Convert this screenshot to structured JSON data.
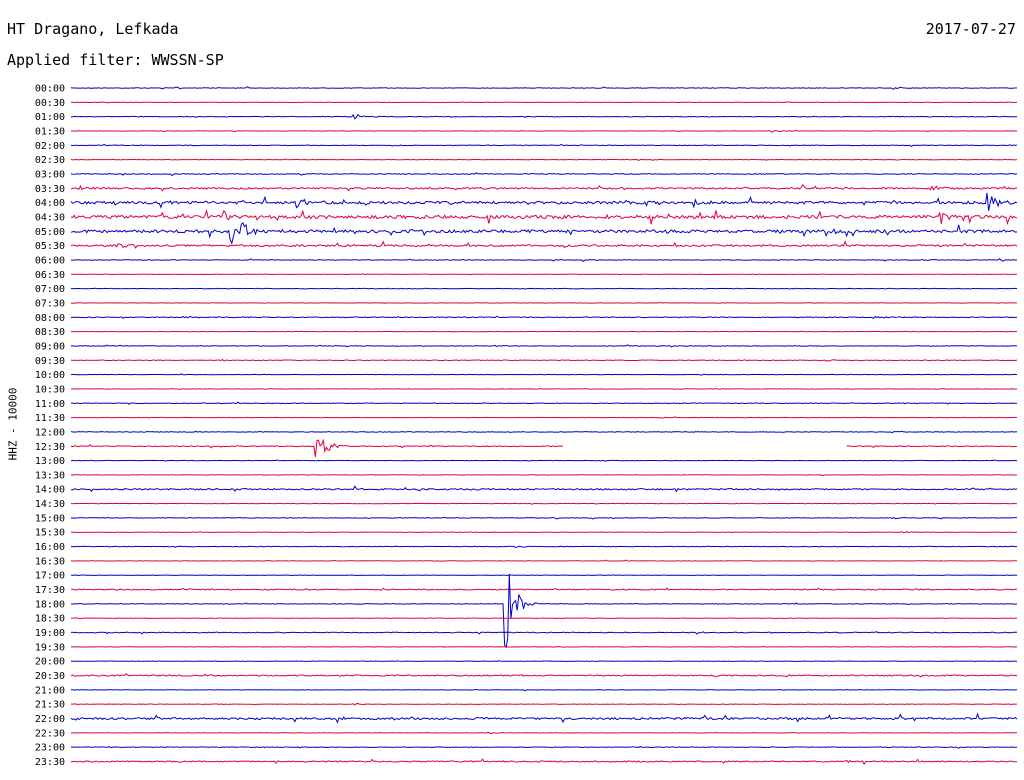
{
  "header": {
    "station": "HT Dragano, Lefkada",
    "date": "2017-07-27",
    "filter": "Applied filter: WWSSN-SP"
  },
  "colors": {
    "trace_a": "#0000cc",
    "trace_b": "#e0003a"
  },
  "chart_data": {
    "type": "line",
    "title": "HT Dragano, Lefkada",
    "subtitle": "Applied filter: WWSSN-SP",
    "ylabel": "HHZ - 10000",
    "xlabel": "",
    "grid": false,
    "legend": "none",
    "rows": [
      {
        "label": "00:00",
        "color": "blue",
        "noise": 0.3,
        "events": [
          {
            "x": 0.11,
            "a": 1
          },
          {
            "x": 0.87,
            "a": 1.2
          }
        ]
      },
      {
        "label": "00:30",
        "color": "red",
        "noise": 0.2,
        "events": []
      },
      {
        "label": "01:00",
        "color": "blue",
        "noise": 0.3,
        "events": [
          {
            "x": 0.3,
            "a": 4
          }
        ]
      },
      {
        "label": "01:30",
        "color": "red",
        "noise": 0.2,
        "events": [
          {
            "x": 0.74,
            "a": 2
          }
        ]
      },
      {
        "label": "02:00",
        "color": "blue",
        "noise": 0.3,
        "events": [
          {
            "x": 0.34,
            "a": 1.5
          }
        ]
      },
      {
        "label": "02:30",
        "color": "red",
        "noise": 0.2,
        "events": []
      },
      {
        "label": "03:00",
        "color": "blue",
        "noise": 0.4,
        "events": []
      },
      {
        "label": "03:30",
        "color": "red",
        "noise": 0.8,
        "events": [
          {
            "x": 0.01,
            "a": 3
          },
          {
            "x": 0.91,
            "a": 3
          }
        ]
      },
      {
        "label": "04:00",
        "color": "blue",
        "noise": 1.3,
        "events": [
          {
            "x": 0.24,
            "a": 6
          },
          {
            "x": 0.61,
            "a": 3
          },
          {
            "x": 0.66,
            "a": 4
          },
          {
            "x": 0.97,
            "a": 10
          }
        ]
      },
      {
        "label": "04:30",
        "color": "red",
        "noise": 1.6,
        "events": [
          {
            "x": 0.16,
            "a": 8
          },
          {
            "x": 0.92,
            "a": 5
          }
        ]
      },
      {
        "label": "05:00",
        "color": "blue",
        "noise": 1.4,
        "events": [
          {
            "x": 0.17,
            "a": 14
          },
          {
            "x": 0.18,
            "a": 10
          },
          {
            "x": 0.8,
            "a": 6
          }
        ]
      },
      {
        "label": "05:30",
        "color": "red",
        "noise": 0.9,
        "events": [
          {
            "x": 0.05,
            "a": 2
          }
        ]
      },
      {
        "label": "06:00",
        "color": "blue",
        "noise": 0.3,
        "events": [
          {
            "x": 0.9,
            "a": 1
          }
        ]
      },
      {
        "label": "06:30",
        "color": "red",
        "noise": 0.2,
        "events": []
      },
      {
        "label": "07:00",
        "color": "blue",
        "noise": 0.3,
        "events": []
      },
      {
        "label": "07:30",
        "color": "red",
        "noise": 0.2,
        "events": []
      },
      {
        "label": "08:00",
        "color": "blue",
        "noise": 0.4,
        "events": [
          {
            "x": 0.12,
            "a": 1
          },
          {
            "x": 0.85,
            "a": 1
          }
        ]
      },
      {
        "label": "08:30",
        "color": "red",
        "noise": 0.2,
        "events": []
      },
      {
        "label": "09:00",
        "color": "blue",
        "noise": 0.3,
        "events": [
          {
            "x": 0.45,
            "a": 1
          }
        ]
      },
      {
        "label": "09:30",
        "color": "red",
        "noise": 0.3,
        "events": [
          {
            "x": 0.16,
            "a": 1
          },
          {
            "x": 0.8,
            "a": 1
          }
        ]
      },
      {
        "label": "10:00",
        "color": "blue",
        "noise": 0.2,
        "events": []
      },
      {
        "label": "10:30",
        "color": "red",
        "noise": 0.2,
        "events": []
      },
      {
        "label": "11:00",
        "color": "blue",
        "noise": 0.3,
        "events": [
          {
            "x": 0.22,
            "a": 1
          },
          {
            "x": 0.88,
            "a": 1
          }
        ]
      },
      {
        "label": "11:30",
        "color": "red",
        "noise": 0.2,
        "events": []
      },
      {
        "label": "12:00",
        "color": "blue",
        "noise": 0.3,
        "events": [
          {
            "x": 0.87,
            "a": 1
          }
        ]
      },
      {
        "label": "12:30",
        "color": "red",
        "noise": 0.4,
        "gap": [
          0.52,
          0.82
        ],
        "events": [
          {
            "x": 0.26,
            "a": 24
          }
        ]
      },
      {
        "label": "13:00",
        "color": "blue",
        "noise": 0.2,
        "events": []
      },
      {
        "label": "13:30",
        "color": "red",
        "noise": 0.2,
        "events": []
      },
      {
        "label": "14:00",
        "color": "blue",
        "noise": 0.7,
        "events": [
          {
            "x": 0.42,
            "a": 1.5
          }
        ]
      },
      {
        "label": "14:30",
        "color": "red",
        "noise": 0.2,
        "events": []
      },
      {
        "label": "15:00",
        "color": "blue",
        "noise": 0.3,
        "events": [
          {
            "x": 0.87,
            "a": 1
          }
        ]
      },
      {
        "label": "15:30",
        "color": "red",
        "noise": 0.2,
        "events": [
          {
            "x": 0.88,
            "a": 1
          }
        ]
      },
      {
        "label": "16:00",
        "color": "blue",
        "noise": 0.3,
        "events": [
          {
            "x": 0.47,
            "a": 1
          }
        ]
      },
      {
        "label": "16:30",
        "color": "red",
        "noise": 0.2,
        "events": []
      },
      {
        "label": "17:00",
        "color": "blue",
        "noise": 0.2,
        "events": []
      },
      {
        "label": "17:30",
        "color": "red",
        "noise": 0.5,
        "events": [
          {
            "x": 0.12,
            "a": 1
          },
          {
            "x": 0.88,
            "a": 1.2
          }
        ]
      },
      {
        "label": "18:00",
        "color": "blue",
        "noise": 0.3,
        "events": [
          {
            "x": 0.46,
            "a": 46
          }
        ]
      },
      {
        "label": "18:30",
        "color": "red",
        "noise": 0.2,
        "events": []
      },
      {
        "label": "19:00",
        "color": "blue",
        "noise": 0.4,
        "events": [
          {
            "x": 0.74,
            "a": 1
          }
        ]
      },
      {
        "label": "19:30",
        "color": "red",
        "noise": 0.2,
        "events": []
      },
      {
        "label": "20:00",
        "color": "blue",
        "noise": 0.2,
        "events": []
      },
      {
        "label": "20:30",
        "color": "red",
        "noise": 0.6,
        "events": [
          {
            "x": 0.14,
            "a": 1.2
          }
        ]
      },
      {
        "label": "21:00",
        "color": "blue",
        "noise": 0.2,
        "events": []
      },
      {
        "label": "21:30",
        "color": "red",
        "noise": 0.2,
        "events": [
          {
            "x": 0.3,
            "a": 1
          }
        ]
      },
      {
        "label": "22:00",
        "color": "blue",
        "noise": 1.0,
        "events": []
      },
      {
        "label": "22:30",
        "color": "red",
        "noise": 0.2,
        "events": [
          {
            "x": 0.44,
            "a": 1
          }
        ]
      },
      {
        "label": "23:00",
        "color": "blue",
        "noise": 0.3,
        "events": [
          {
            "x": 0.2,
            "a": 1
          }
        ]
      },
      {
        "label": "23:30",
        "color": "red",
        "noise": 0.6,
        "events": [
          {
            "x": 0.82,
            "a": 1
          }
        ]
      }
    ]
  }
}
